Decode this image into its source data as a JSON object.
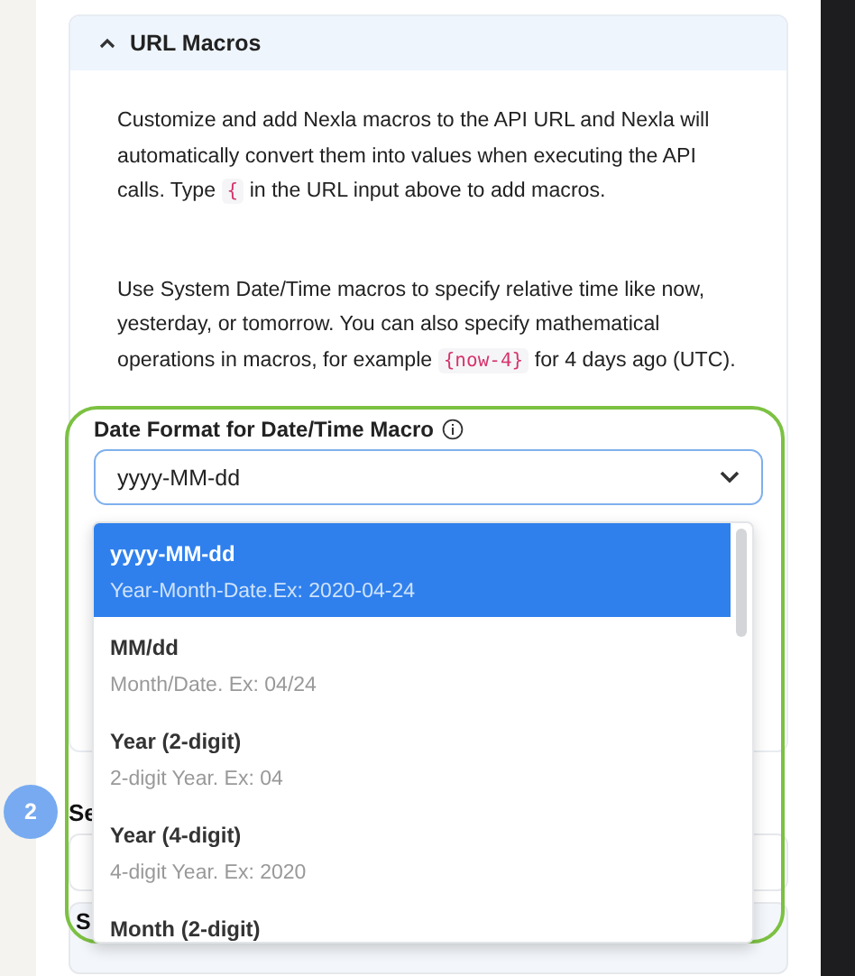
{
  "section": {
    "title": "URL Macros",
    "expanded": true,
    "paragraphs": [
      [
        {
          "kind": "text",
          "text": "Customize and add Nexla macros to the API URL and Nexla will automatically convert them into values when executing the API calls. Type "
        },
        {
          "kind": "code",
          "text": "{"
        },
        {
          "kind": "text",
          "text": " in the URL input above to add macros."
        }
      ],
      [
        {
          "kind": "text",
          "text": "Use System Date/Time macros to specify relative time like now, yesterday, or tomorrow. You can also specify mathematical operations in macros, for example "
        },
        {
          "kind": "code",
          "text": "{now-4}"
        },
        {
          "kind": "text",
          "text": " for 4 days ago (UTC)."
        }
      ]
    ],
    "field": {
      "label": "Date Format for Date/Time Macro",
      "value": "yyyy-MM-dd",
      "open": true,
      "options": [
        {
          "label": "yyyy-MM-dd",
          "description": "Year-Month-Date.Ex: 2020-04-24",
          "selected": true
        },
        {
          "label": "MM/dd",
          "description": "Month/Date. Ex: 04/24",
          "selected": false
        },
        {
          "label": "Year (2-digit)",
          "description": "2-digit Year. Ex: 04",
          "selected": false
        },
        {
          "label": "Year (4-digit)",
          "description": "4-digit Year. Ex: 2020",
          "selected": false
        },
        {
          "label": "Month (2-digit)",
          "selected": false
        }
      ]
    }
  },
  "step": {
    "number": "2",
    "title": "Se"
  },
  "next_section": {
    "title": "S"
  }
}
